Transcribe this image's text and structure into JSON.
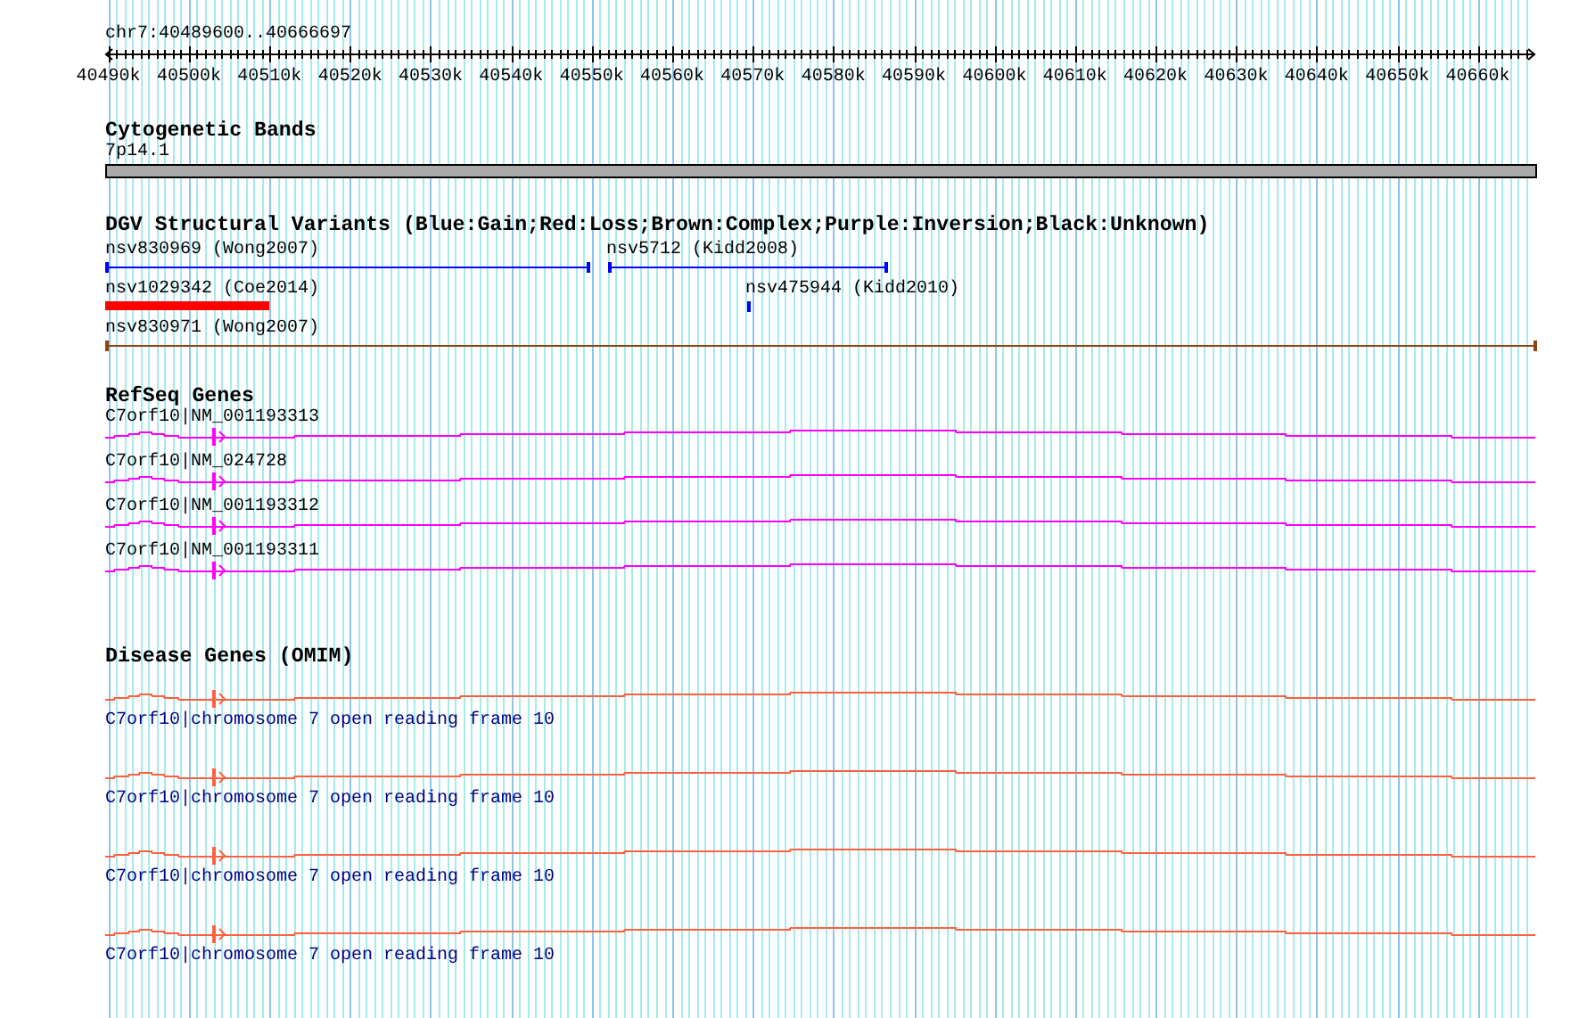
{
  "ruler": {
    "title": "chr7:40489600..40666697",
    "ticks": [
      "40490k",
      "40500k",
      "40510k",
      "40520k",
      "40530k",
      "40540k",
      "40550k",
      "40560k",
      "40570k",
      "40580k",
      "40590k",
      "40600k",
      "40610k",
      "40620k",
      "40630k",
      "40640k",
      "40650k",
      "40660k"
    ]
  },
  "tracks": [
    {
      "kind": "bands",
      "title": "Cytogenetic Bands",
      "features": [
        {
          "label": "7p14.1"
        }
      ]
    },
    {
      "kind": "variants",
      "title": "DGV Structural Variants (Blue:Gain;Red:Loss;Brown:Complex;Purple:Inversion;Black:Unknown)",
      "rows": [
        [
          {
            "label": "nsv830969 (Wong2007)",
            "color": "#0000ff"
          },
          {
            "label": "nsv5712 (Kidd2008)",
            "color": "#0000ff"
          }
        ],
        [
          {
            "label": "nsv1029342 (Coe2014)",
            "color": "#ff0000"
          },
          {
            "label": "nsv475944 (Kidd2010)",
            "color": "#0000ff"
          }
        ],
        [
          {
            "label": "nsv830971 (Wong2007)",
            "color": "#8b4513"
          }
        ]
      ]
    },
    {
      "kind": "genes",
      "title": "RefSeq Genes",
      "features": [
        {
          "label": "C7orf10|NM_001193313"
        },
        {
          "label": "C7orf10|NM_024728"
        },
        {
          "label": "C7orf10|NM_001193312"
        },
        {
          "label": "C7orf10|NM_001193311"
        }
      ]
    },
    {
      "kind": "disease",
      "title": "Disease Genes (OMIM)",
      "features": [
        {
          "label": "C7orf10|chromosome 7 open reading frame 10"
        },
        {
          "label": "C7orf10|chromosome 7 open reading frame 10"
        },
        {
          "label": "C7orf10|chromosome 7 open reading frame 10"
        },
        {
          "label": "C7orf10|chromosome 7 open reading frame 10"
        }
      ]
    }
  ]
}
